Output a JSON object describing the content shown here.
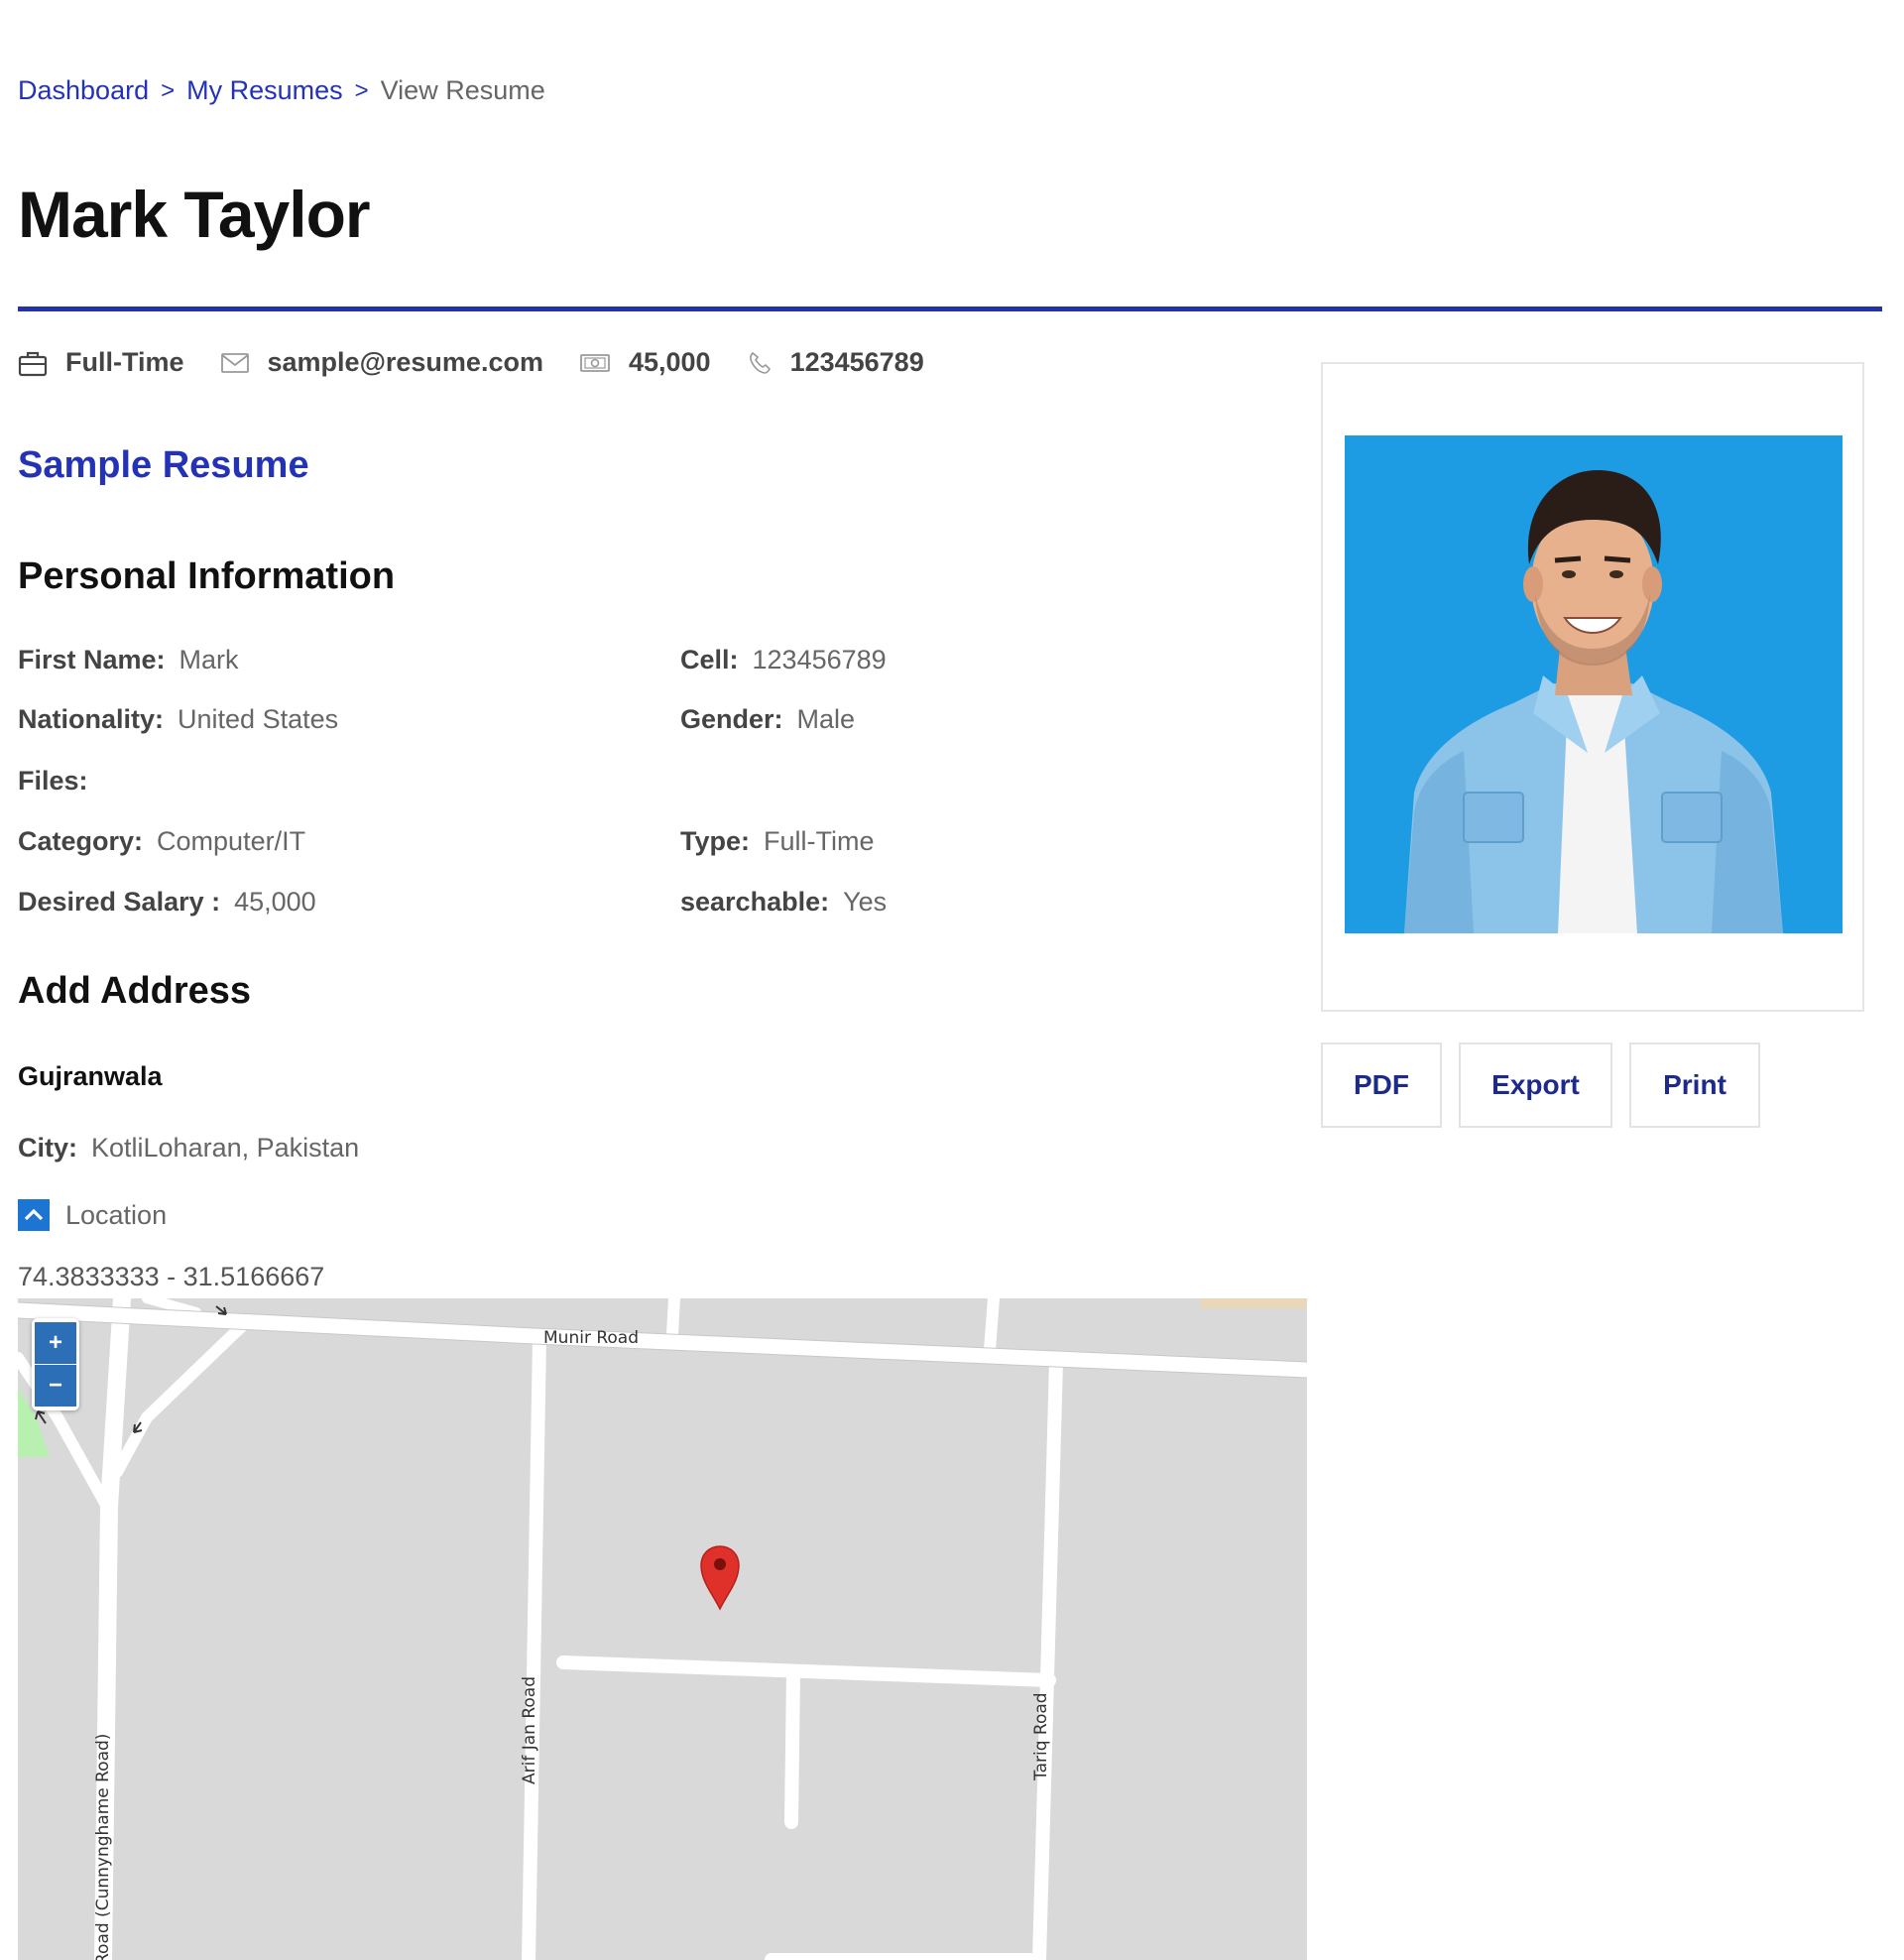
{
  "breadcrumb": {
    "items": [
      {
        "label": "Dashboard"
      },
      {
        "label": "My Resumes"
      }
    ],
    "separator": ">",
    "current": "View Resume"
  },
  "page_title": "Mark Taylor",
  "meta": {
    "job_type": "Full-Time",
    "email": "sample@resume.com",
    "salary": "45,000",
    "phone": "123456789"
  },
  "resume_title": "Sample Resume",
  "personal_info": {
    "heading": "Personal Information",
    "first_name": {
      "label": "First Name:",
      "value": "Mark"
    },
    "cell": {
      "label": "Cell:",
      "value": "123456789"
    },
    "nationality": {
      "label": "Nationality:",
      "value": "United States"
    },
    "gender": {
      "label": "Gender:",
      "value": "Male"
    },
    "files": {
      "label": "Files:",
      "value": ""
    },
    "category": {
      "label": "Category:",
      "value": "Computer/IT"
    },
    "type": {
      "label": "Type:",
      "value": "Full-Time"
    },
    "desired_salary": {
      "label": "Desired Salary :",
      "value": "45,000"
    },
    "searchable": {
      "label": "searchable:",
      "value": "Yes"
    }
  },
  "address": {
    "heading": "Add Address",
    "name": "Gujranwala",
    "city": {
      "label": "City:",
      "value": "KotliLoharan, Pakistan"
    },
    "location_toggle": "Location",
    "coordinates": "74.3833333 - 31.5166667"
  },
  "map": {
    "zoom_in": "+",
    "zoom_out": "−",
    "roads": {
      "munir": "Munir Road",
      "arif_jan": "Arif Jan Road",
      "tariq": "Tariq Road",
      "cunnynghame": "Road (Cunnynghame Road)"
    },
    "pin_color": "#e0302a"
  },
  "actions": {
    "pdf": "PDF",
    "export": "Export",
    "print": "Print"
  },
  "colors": {
    "accent": "#2433b5",
    "rule": "#2431a8",
    "photo_bg": "#1ea1e8"
  },
  "icons": {
    "job_type": "briefcase-icon",
    "email": "envelope-icon",
    "salary": "money-icon",
    "phone": "phone-icon",
    "toggle": "chevron-up-icon",
    "pin": "map-pin-icon"
  }
}
